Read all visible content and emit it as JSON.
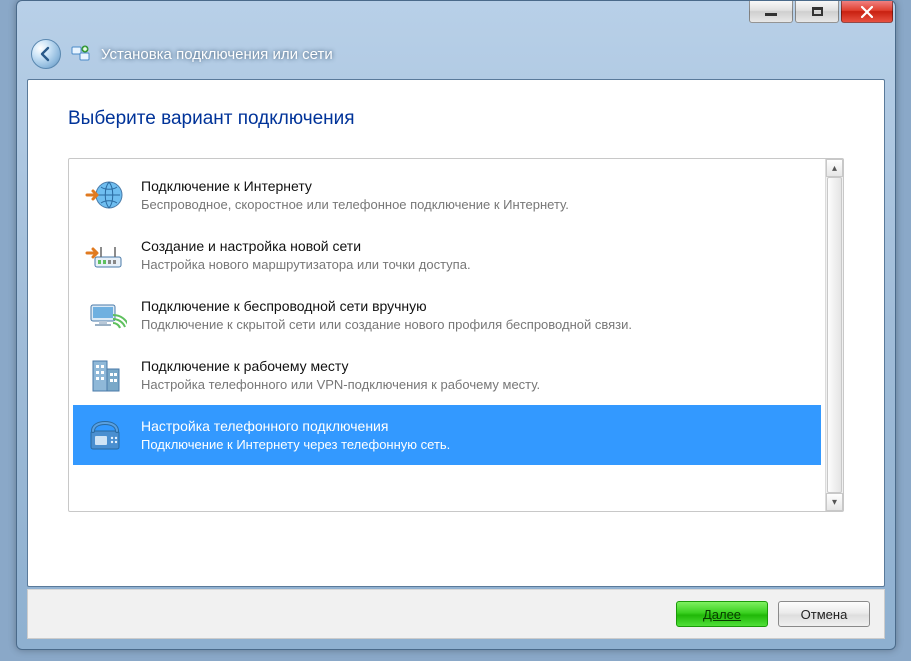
{
  "window": {
    "title": "Установка подключения или сети"
  },
  "page": {
    "heading": "Выберите вариант подключения"
  },
  "options": [
    {
      "icon": "globe-arrow-icon",
      "title": "Подключение к Интернету",
      "desc": "Беспроводное, скоростное или телефонное подключение к Интернету.",
      "selected": false
    },
    {
      "icon": "router-arrow-icon",
      "title": "Создание и настройка новой сети",
      "desc": "Настройка нового маршрутизатора или точки доступа.",
      "selected": false
    },
    {
      "icon": "wireless-monitor-icon",
      "title": "Подключение к беспроводной сети вручную",
      "desc": "Подключение к скрытой сети или создание нового профиля беспроводной связи.",
      "selected": false
    },
    {
      "icon": "building-icon",
      "title": "Подключение к рабочему месту",
      "desc": "Настройка телефонного или VPN-подключения к рабочему месту.",
      "selected": false
    },
    {
      "icon": "phone-modem-icon",
      "title": "Настройка телефонного подключения",
      "desc": "Подключение к Интернету через телефонную сеть.",
      "selected": true
    }
  ],
  "buttons": {
    "next": "Далее",
    "cancel": "Отмена"
  },
  "colors": {
    "selection": "#3399ff",
    "heading": "#003399",
    "primary_btn": "#2ecc40"
  }
}
